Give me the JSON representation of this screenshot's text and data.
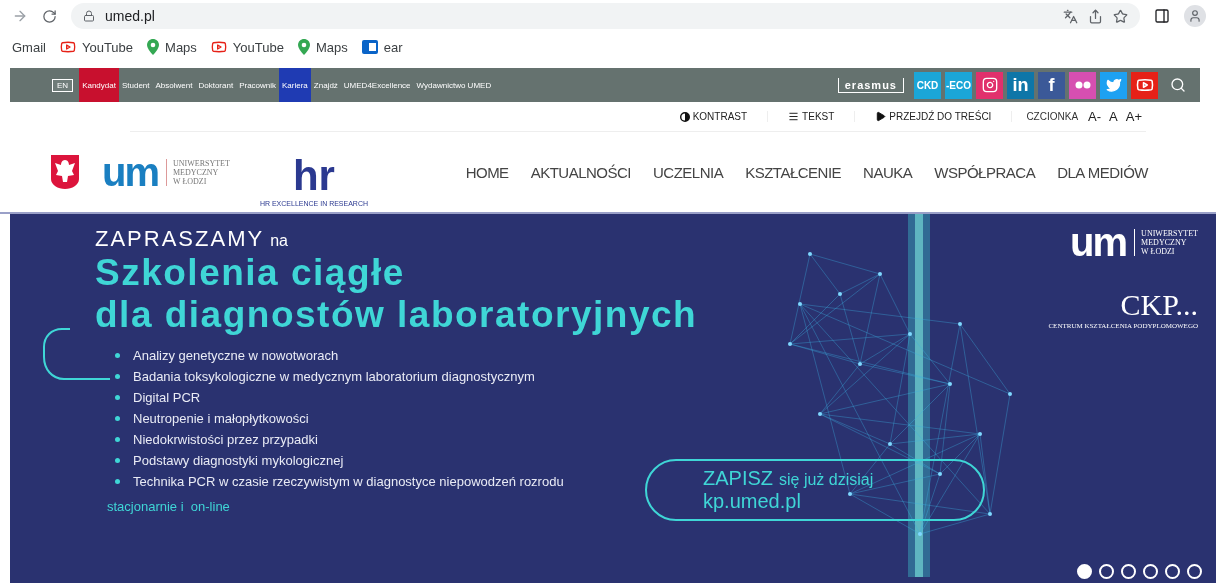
{
  "browser": {
    "url": "umed.pl",
    "bookmarks": [
      {
        "kind": "plain",
        "label": "Gmail"
      },
      {
        "kind": "youtube",
        "label": "YouTube"
      },
      {
        "kind": "maps",
        "label": "Maps"
      },
      {
        "kind": "youtube",
        "label": "YouTube"
      },
      {
        "kind": "maps",
        "label": "Maps"
      },
      {
        "kind": "outlook",
        "label": "ear"
      }
    ]
  },
  "topbar": {
    "language": "EN",
    "links": [
      {
        "label": "Kandydat",
        "color": "#c8102e"
      },
      {
        "label": "Student"
      },
      {
        "label": "Absolwent"
      },
      {
        "label": "Doktorant"
      },
      {
        "label": "Pracownik"
      },
      {
        "label": "Kariera",
        "color": "#1f3bb3"
      },
      {
        "label": "Znajdź"
      },
      {
        "label": "UMED4Excellence"
      },
      {
        "label": "Wydawnictwo UMED"
      }
    ],
    "socials": [
      {
        "kind": "erasmus",
        "label": "erasmus"
      },
      {
        "kind": "ckd",
        "label": "CKD"
      },
      {
        "kind": "eco",
        "label": "-ECO"
      },
      {
        "kind": "instagram"
      },
      {
        "kind": "linkedin",
        "label": "in"
      },
      {
        "kind": "facebook",
        "label": "f"
      },
      {
        "kind": "flickr"
      },
      {
        "kind": "twitter"
      },
      {
        "kind": "youtube"
      }
    ]
  },
  "accessibility": {
    "items": [
      {
        "kind": "contrast",
        "label": "KONTRAST"
      },
      {
        "kind": "text",
        "label": "TEKST"
      },
      {
        "kind": "skip",
        "label": "PRZEJDŹ DO TREŚCI"
      }
    ],
    "font_label": "CZCIONKA",
    "font_sizes": [
      "A-",
      "A",
      "A+"
    ]
  },
  "logos": {
    "um_mark": "um",
    "um_lines": [
      "UNIWERSYTET",
      "MEDYCZNY",
      "W ŁODZI"
    ],
    "hr_mark": "hr",
    "hr_caption": "HR EXCELLENCE IN RESEARCH"
  },
  "nav": [
    "HOME",
    "AKTUALNOŚCI",
    "UCZELNIA",
    "KSZTAŁCENIE",
    "NAUKA",
    "WSPÓŁPRACA",
    "DLA MEDIÓW"
  ],
  "banner": {
    "intro_lead": "ZAPRASZAMY",
    "intro_tail": "na",
    "title_lines": [
      "Szkolenia ciągłe",
      "dla diagnostów laboratoryjnych"
    ],
    "bullets": [
      "Analizy genetyczne w nowotworach",
      "Badania toksykologiczne w medycznym laboratorium diagnostycznym",
      "Digital PCR",
      "Neutropenie i małopłytkowości",
      "Niedokrwistości przez przypadki",
      "Podstawy diagnostyki mykologicznej",
      "Technika PCR w czasie rzeczywistym w diagnostyce niepowodzeń rozrodu"
    ],
    "mode": "stacjonarnie i  on-line",
    "cta_lead": "ZAPISZ",
    "cta_tail": "się już dzisiaj",
    "cta_url": "kp.umed.pl",
    "um_mark": "um",
    "um_lines": [
      "UNIWERSYTET",
      "MEDYCZNY",
      "W ŁODZI"
    ],
    "ckp_mark": "CKP...",
    "ckp_caption": "CENTRUM KSZTAŁCENIA PODYPLOMOWEGO",
    "slides": [
      {
        "selected": true
      },
      {
        "selected": false
      },
      {
        "selected": false
      },
      {
        "selected": false
      },
      {
        "selected": false
      },
      {
        "selected": false
      }
    ]
  }
}
